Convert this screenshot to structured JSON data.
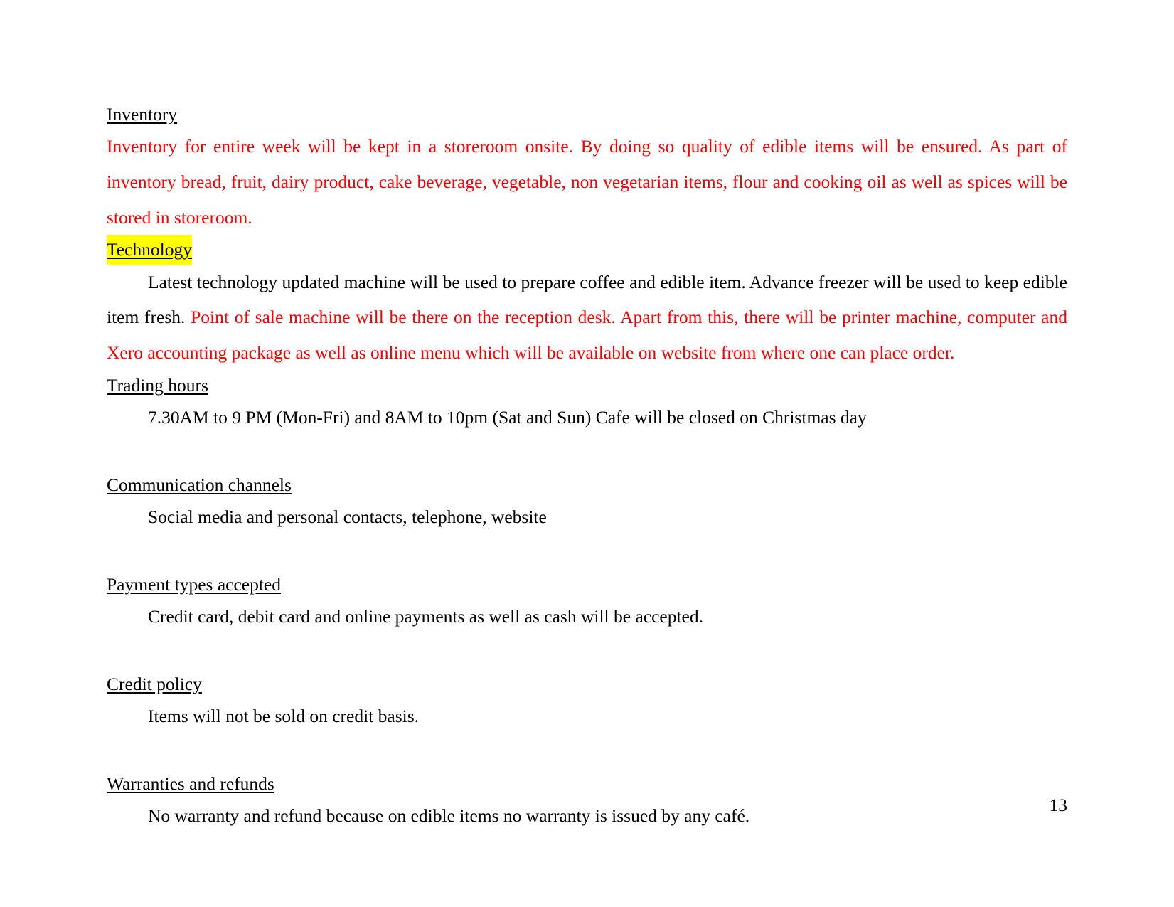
{
  "document": {
    "page_number": "13",
    "colors": {
      "revision_red": "#ff0000",
      "highlight_yellow": "#ffff00",
      "body_black": "#000000"
    },
    "sections": [
      {
        "id": "inventory",
        "heading": "Inventory",
        "heading_highlighted": false,
        "paragraphs": [
          {
            "id": "inventory-body",
            "color": "red",
            "text": "Inventory for entire week will be kept in a storeroom onsite. By doing so quality of edible items will be ensured. As part of inventory bread, fruit, dairy product, cake beverage, vegetable, non vegetarian items, flour and cooking oil as well as spices will be stored in storeroom."
          }
        ]
      },
      {
        "id": "technology",
        "heading": "Technology",
        "heading_highlighted": true,
        "paragraphs": [
          {
            "id": "technology-body",
            "color": "mixed",
            "text_black_lead": "Latest technology updated machine will be used to prepare coffee and edible item. Advance freezer will be used to keep edible item fresh. ",
            "text_red_tail": "Point of sale machine will be there on the reception desk. Apart from this, there will be printer machine, computer and Xero accounting package as well as online menu which will be available on website from where one can place order."
          }
        ]
      },
      {
        "id": "trading-hours",
        "heading": "Trading hours",
        "heading_highlighted": false,
        "paragraphs": [
          {
            "id": "trading-hours-body",
            "color": "black",
            "text": "7.30AM to 9 PM (Mon-Fri) and 8AM to 10pm (Sat and Sun) Cafe will be closed on Christmas day"
          }
        ]
      },
      {
        "id": "communication-channels",
        "heading": "Communication channels",
        "heading_highlighted": false,
        "paragraphs": [
          {
            "id": "communication-channels-body",
            "color": "black",
            "text": "Social media and personal contacts, telephone, website"
          }
        ]
      },
      {
        "id": "payment-types-accepted",
        "heading": "Payment types accepted",
        "heading_highlighted": false,
        "paragraphs": [
          {
            "id": "payment-types-body",
            "color": "black",
            "text": "Credit card, debit card and online payments as well as cash will be accepted."
          }
        ]
      },
      {
        "id": "credit-policy",
        "heading": "Credit policy",
        "heading_highlighted": false,
        "paragraphs": [
          {
            "id": "credit-policy-body",
            "color": "black",
            "text": "Items will not be sold on credit basis."
          }
        ]
      },
      {
        "id": "warranties-and-refunds",
        "heading": "Warranties and refunds",
        "heading_highlighted": false,
        "paragraphs": [
          {
            "id": "warranties-and-refunds-body",
            "color": "black",
            "text": "No warranty and refund because on edible items no warranty is issued by any café."
          }
        ]
      }
    ]
  }
}
